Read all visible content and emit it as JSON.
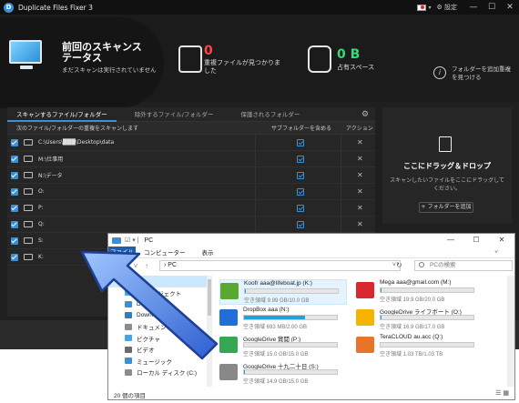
{
  "app": {
    "title": "Duplicate Files Fixer 3",
    "settings_label": "⚙ 設定",
    "flag_caret": "▾",
    "min": "—",
    "max": "☐",
    "close": "✕"
  },
  "header": {
    "scan_title": "前回のスキャンステータス",
    "scan_sub": "まだスキャンは実行されていません",
    "dup_count": "0",
    "dup_label": "重複ファイルが見つかりました",
    "space_count": "0 B",
    "space_label": "占有スペース",
    "info_text": "フォルダーを追加重複を見つける"
  },
  "panel": {
    "tabs": [
      "スキャンするファイル/フォルダー",
      "除外するファイル/フォルダー",
      "保護されるフォルダー"
    ],
    "col_main": "次のファイル/フォルダーの重複をスキャンします",
    "col_sub": "サブフォルダーを含める",
    "col_action": "アクション",
    "rows": [
      {
        "path": "C:\\Users\\███\\Desktop\\data"
      },
      {
        "path": "M:\\仕事用"
      },
      {
        "path": "N:\\データ"
      },
      {
        "path": "O:"
      },
      {
        "path": "P:"
      },
      {
        "path": "Q:"
      },
      {
        "path": "S:"
      },
      {
        "path": "K:"
      }
    ],
    "delete_glyph": "✕"
  },
  "drop": {
    "title": "ここにドラッグ＆ドロップ",
    "sub": "スキャンしたいファイルをここにドラッグしてください。",
    "add_button": "+ フォルダーを追加"
  },
  "explorer": {
    "title": "PC",
    "quick_access": "☑ ▾ |",
    "ribbon_file": "ファイル",
    "ribbon_tabs": [
      "コンピューター",
      "表示"
    ],
    "ribbon_caret": "˅",
    "nav_back": "←",
    "nav_fwd": "→",
    "nav_hist": "˅",
    "nav_up": "↑",
    "address": "›  PC",
    "address_caret": "˅",
    "refresh": "↻",
    "search_placeholder": "PCの検索",
    "tree": [
      {
        "label": "",
        "color": "#3a8fd6"
      },
      {
        "label": "3D オブジェクト",
        "color": "#4aa3e0"
      },
      {
        "label": "Desktop",
        "color": "#3a8fd6"
      },
      {
        "label": "Downloads",
        "color": "#2b7fc4"
      },
      {
        "label": "ドキュメント",
        "color": "#8c8c8c"
      },
      {
        "label": "ピクチャ",
        "color": "#4aa3e0"
      },
      {
        "label": "ビデオ",
        "color": "#6b6b6b"
      },
      {
        "label": "ミュージック",
        "color": "#3a8fd6"
      },
      {
        "label": "ローカル ディスク (C:)",
        "color": "#8c8c8c"
      }
    ],
    "drives": [
      {
        "name": "Koofr aaa@lifeboat.jp (K:)",
        "size": "空き領域 9.99 GB/10.0 GB",
        "fill": 0.01,
        "color": "#5aa832"
      },
      {
        "name": "Mega aaa@gmail.com (M:)",
        "size": "空き領域 19.9 GB/20.0 GB",
        "fill": 0.01,
        "color": "#d9272e"
      },
      {
        "name": "DropBox aaa (N:)",
        "size": "空き領域 693 MB/2.00 GB",
        "fill": 0.66,
        "color": "#1f6fd6"
      },
      {
        "name": "GoogleDrive ライフボート (O:)",
        "size": "空き領域 16.9 GB/17.0 GB",
        "fill": 0.01,
        "color": "#f4b400"
      },
      {
        "name": "GoogleDrive 賞閲 (P:)",
        "size": "空き領域 15.0 GB/15.0 GB",
        "fill": 0.0,
        "color": "#34a853"
      },
      {
        "name": "TeraCLOUD au.acc (Q:)",
        "size": "空き領域 1.03 TB/1.03 TB",
        "fill": 0.0,
        "color": "#e8742a"
      },
      {
        "name": "GoogleDrive 十九二十日 (S:)",
        "size": "空き領域 14.9 GB/15.0 GB",
        "fill": 0.01,
        "color": "#888888"
      }
    ],
    "status": "20 個の項目",
    "view_buttons": "☰ ▦"
  }
}
